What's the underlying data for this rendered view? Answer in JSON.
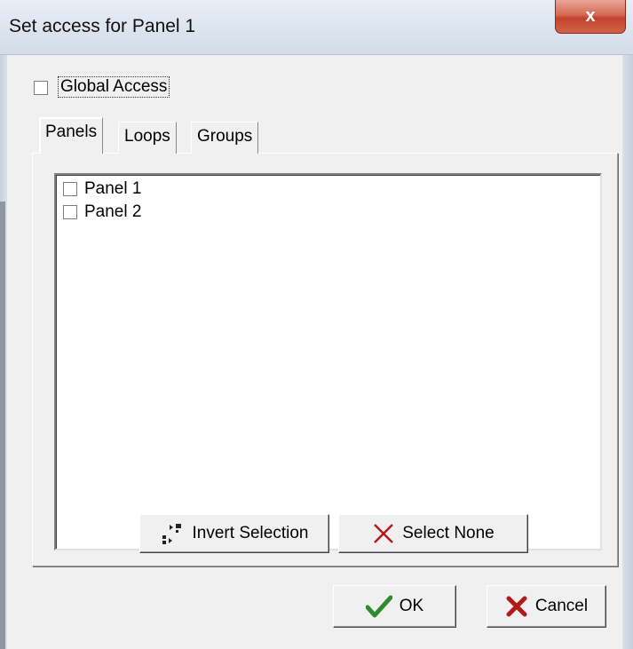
{
  "window": {
    "title": "Set access for Panel 1",
    "close_label": "x"
  },
  "global_access": {
    "label": "Global Access",
    "checked": false
  },
  "tabs": [
    {
      "label": "Panels",
      "active": true
    },
    {
      "label": "Loops",
      "active": false
    },
    {
      "label": "Groups",
      "active": false
    }
  ],
  "list": {
    "items": [
      {
        "label": "Panel 1",
        "checked": false
      },
      {
        "label": "Panel 2",
        "checked": false
      }
    ]
  },
  "actions": {
    "invert_label": "Invert Selection",
    "select_none_label": "Select None"
  },
  "dialog_buttons": {
    "ok_label": "OK",
    "cancel_label": "Cancel"
  },
  "colors": {
    "ok_check": "#2e8b2e",
    "cancel_x": "#b21a1a",
    "select_none_x": "#b21a1a"
  },
  "icons": {
    "invert": "invert-selection-icon",
    "select_none": "x-icon",
    "ok": "checkmark-icon",
    "cancel": "cross-icon"
  }
}
